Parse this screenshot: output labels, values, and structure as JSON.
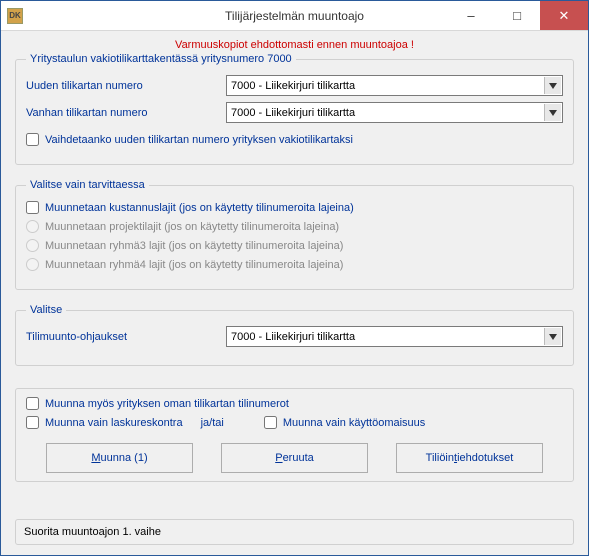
{
  "window": {
    "title": "Tilijärjestelmän muuntoajo",
    "icon_label": "DK",
    "minimize": "–",
    "maximize": "□",
    "close": "✕"
  },
  "warning": "Varmuuskopiot ehdottomasti ennen muuntoajoa !",
  "group1": {
    "legend": "Yritystaulun vakiotilikarttakentässä yritysnumero   7000",
    "new_chart_label": "Uuden tilikartan numero",
    "old_chart_label": "Vanhan tilikartan numero",
    "combo_value": "7000 - Liikekirjuri tilikartta",
    "swap_checkbox": "Vaihdetaanko uuden tilikartan numero yrityksen vakiotilikartaksi"
  },
  "group2": {
    "legend": "Valitse vain tarvittaessa",
    "opt_cost": "Muunnetaan kustannuslajit (jos on käytetty tilinumeroita lajeina)",
    "opt_project": "Muunnetaan projektilajit (jos on käytetty tilinumeroita lajeina)",
    "opt_group3": "Muunnetaan ryhmä3 lajit (jos on käytetty tilinumeroita lajeina)",
    "opt_group4": "Muunnetaan ryhmä4 lajit (jos on käytetty tilinumeroita lajeina)"
  },
  "group3": {
    "legend": "Valitse",
    "label": "Tilimuunto-ohjaukset",
    "combo_value": "7000 - Liikekirjuri tilikartta"
  },
  "convert": {
    "own_chart": "Muunna myös yrityksen oman tilikartan tilinumerot",
    "invoice_ledger": "Muunna vain laskureskontra",
    "and_or": "ja/tai",
    "fixed_assets": "Muunna vain käyttöomaisuus"
  },
  "buttons": {
    "convert_pre": "M",
    "convert_post": "uunna (1)",
    "cancel_pre": "P",
    "cancel_post": "eruuta",
    "suggestions_pre": "Tiliöin",
    "suggestions_u": "t",
    "suggestions_post": "iehdotukset"
  },
  "status": "Suorita muuntoajon 1. vaihe"
}
